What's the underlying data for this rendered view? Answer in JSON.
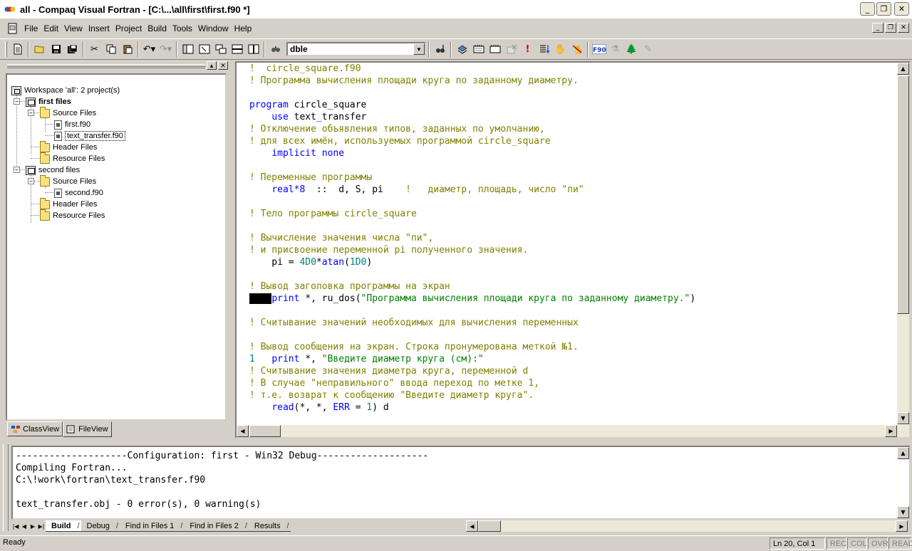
{
  "window": {
    "title": "all - Compaq Visual Fortran - [C:\\...\\all\\first\\first.f90 *]",
    "minimize": "_",
    "maximize": "❐",
    "close": "✕"
  },
  "menu": {
    "items": [
      "File",
      "Edit",
      "View",
      "Insert",
      "Project",
      "Build",
      "Tools",
      "Window",
      "Help"
    ]
  },
  "toolbar": {
    "combo_value": "dble"
  },
  "workspace": {
    "root": "Workspace 'all': 2 project(s)",
    "projects": [
      {
        "name": "first files",
        "folders": [
          "Source Files",
          "Header Files",
          "Resource Files"
        ],
        "source_files": [
          "first.f90",
          "text_transfer.f90"
        ]
      },
      {
        "name": "second files",
        "folders": [
          "Source Files",
          "Header Files",
          "Resource Files"
        ],
        "source_files": [
          "second.f90"
        ]
      }
    ],
    "tabs": [
      "ClassView",
      "FileView"
    ]
  },
  "editor": {
    "lines": [
      "!  circle_square.f90",
      "! Программа вычисления площади круга по заданному диаметру.",
      "",
      "program circle_square",
      "    use text_transfer",
      "! Отключение объявления типов, заданных по умолчанию,",
      "! для всех имён, используемых программой circle_square",
      "    implicit none",
      "",
      "! Переменные программы",
      "    real*8  ::  d, S, pi    !   диаметр, площадь, число \"пи\"",
      "",
      "! Тело программы circle_square",
      "",
      "! Вычисление значения числа \"пи\",",
      "! и присвоение переменной pi полученного значения.",
      "    pi = 4D0*atan(1D0)",
      "",
      "! Вывод заголовка программы на экран",
      "    print *, ru_dos(\"Программа вычисления площади круга по заданному диаметру.\")",
      "",
      "! Считывание значений необходимых для вычисления переменных",
      "",
      "! Вывод сообщения на экран. Строка пронумерована меткой №1.",
      "1   print *, \"Введите диаметр круга (см):\"",
      "! Считывание значения диаметра круга, переменной d",
      "! В случае \"неправильного\" ввода переход по метке 1,",
      "! т.е. возврат к сообщению \"Введите диаметр круга\".",
      "    read(*, *, ERR = 1) d"
    ]
  },
  "output": {
    "lines": [
      "--------------------Configuration: first - Win32 Debug--------------------",
      "Compiling Fortran...",
      "C:\\!work\\fortran\\text_transfer.f90",
      "",
      "text_transfer.obj - 0 error(s), 0 warning(s)"
    ],
    "tabs": [
      "Build",
      "Debug",
      "Find in Files 1",
      "Find in Files 2",
      "Results"
    ]
  },
  "status": {
    "ready": "Ready",
    "position": "Ln 20, Col 1",
    "indicators": [
      "REC",
      "COL",
      "OVR",
      "READ"
    ]
  }
}
